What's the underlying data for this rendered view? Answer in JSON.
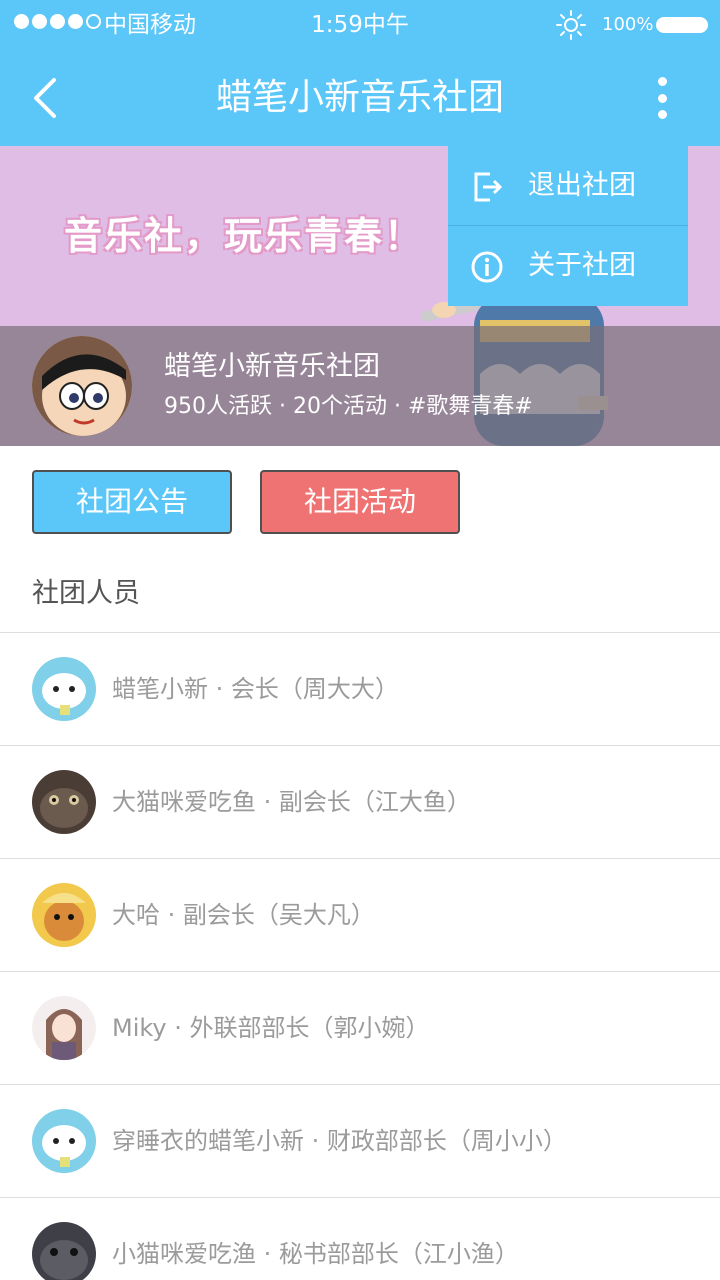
{
  "status_bar": {
    "carrier": "中国移动",
    "time": "1:59中午",
    "battery": "100%"
  },
  "nav": {
    "title": "蜡笔小新音乐社团"
  },
  "banner": {
    "slogan": "音乐社，玩乐青春！",
    "club_name": "蜡笔小新音乐社团",
    "club_stats": "950人活跃 · 20个活动 · #歌舞青春#"
  },
  "menu": {
    "items": [
      {
        "label": "退出社团",
        "icon": "exit-icon"
      },
      {
        "label": "关于社团",
        "icon": "info-icon"
      }
    ]
  },
  "buttons": {
    "notice": "社团公告",
    "activity": "社团活动"
  },
  "members": {
    "title": "社团人员",
    "items": [
      {
        "text": "蜡笔小新 · 会长（周大大）"
      },
      {
        "text": "大猫咪爱吃鱼 · 副会长（江大鱼）"
      },
      {
        "text": "大哈 · 副会长（吴大凡）"
      },
      {
        "text": "Miky · 外联部部长（郭小婉）"
      },
      {
        "text": "穿睡衣的蜡笔小新 · 财政部部长（周小小）"
      },
      {
        "text": "小猫咪爱吃渔 · 秘书部部长（江小渔）"
      }
    ]
  },
  "colors": {
    "primary": "#5bc6f8",
    "activity_button": "#ef7373",
    "banner_bg": "#dfbde5"
  }
}
